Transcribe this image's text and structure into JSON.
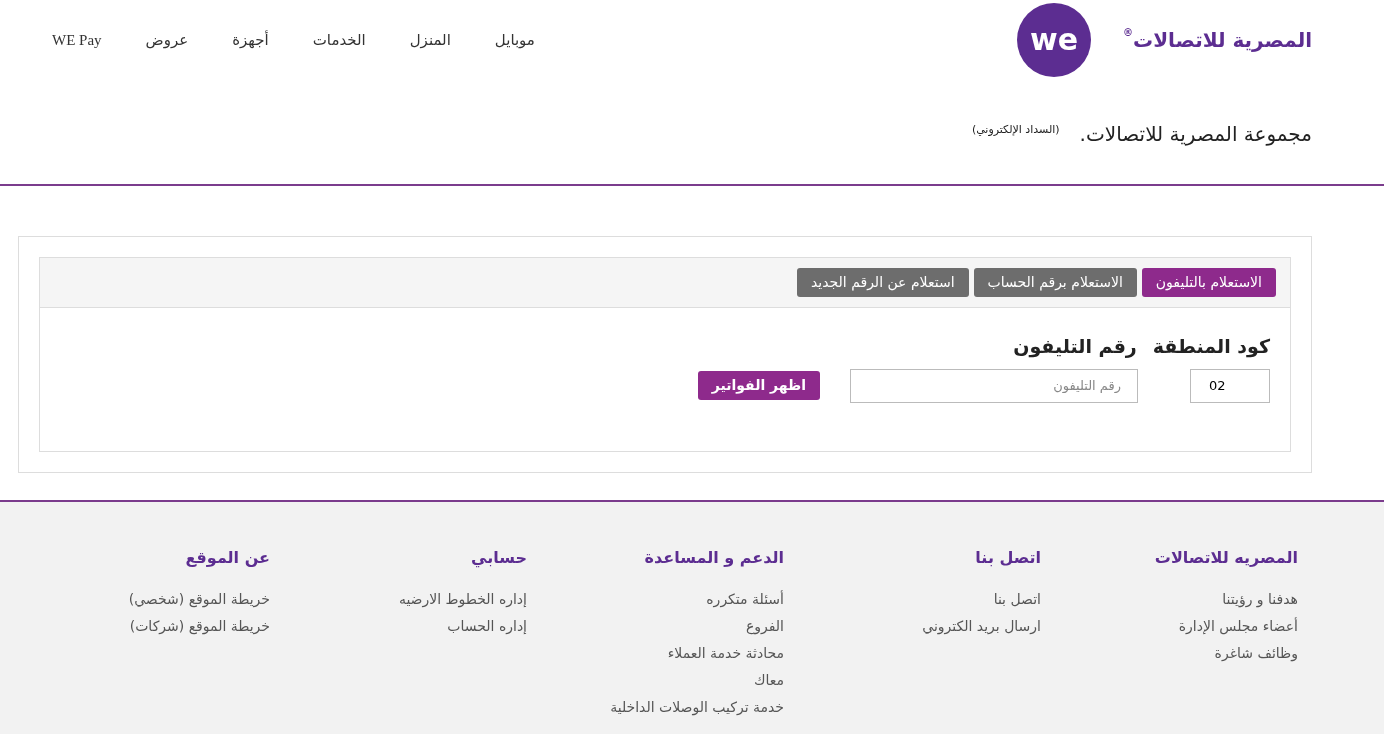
{
  "header": {
    "brand": {
      "name": "المصرية للاتصالات",
      "mark": "®",
      "logo": "we"
    },
    "nav": [
      {
        "label": "موبايل"
      },
      {
        "label": "المنزل"
      },
      {
        "label": "الخدمات"
      },
      {
        "label": "أجهزة"
      },
      {
        "label": "عروض"
      },
      {
        "label": "WE Pay"
      }
    ]
  },
  "page_title": {
    "title": "مجموعة المصرية للاتصالات.",
    "subtitle": "(السداد الإلكتروني)"
  },
  "inquiry": {
    "tabs": [
      {
        "label": "الاستعلام بالتليفون",
        "selected": true
      },
      {
        "label": "الاستعلام برقم الحساب",
        "selected": false
      },
      {
        "label": "استعلام عن الرقم الجديد",
        "selected": false
      }
    ],
    "area_code": {
      "label": "كود المنطقة",
      "value": "02"
    },
    "phone": {
      "label": "رقم التليفون",
      "placeholder": "رقم التليفون"
    },
    "submit": "اظهر الفواتير"
  },
  "footer": {
    "columns": [
      {
        "title": "المصريه للاتصالات",
        "links": [
          "هدفنا و رؤيتنا",
          "أعضاء مجلس الإدارة",
          "وظائف شاغرة"
        ]
      },
      {
        "title": "اتصل بنا",
        "links": [
          "اتصل بنا",
          "ارسال بريد الكتروني"
        ]
      },
      {
        "title": "الدعم و المساعدة",
        "links": [
          "أسئلة متكرره",
          "الفروع",
          "محادثة خدمة العملاء",
          "معاك",
          "خدمة تركيب الوصلات الداخلية"
        ]
      },
      {
        "title": "حسابي",
        "links": [
          "إداره الخطوط الارضيه",
          "إداره الحساب"
        ]
      },
      {
        "title": "عن الموقع",
        "links": [
          "خريطة الموقع (شخصي)",
          "خريطة الموقع (شركات)"
        ]
      }
    ]
  }
}
